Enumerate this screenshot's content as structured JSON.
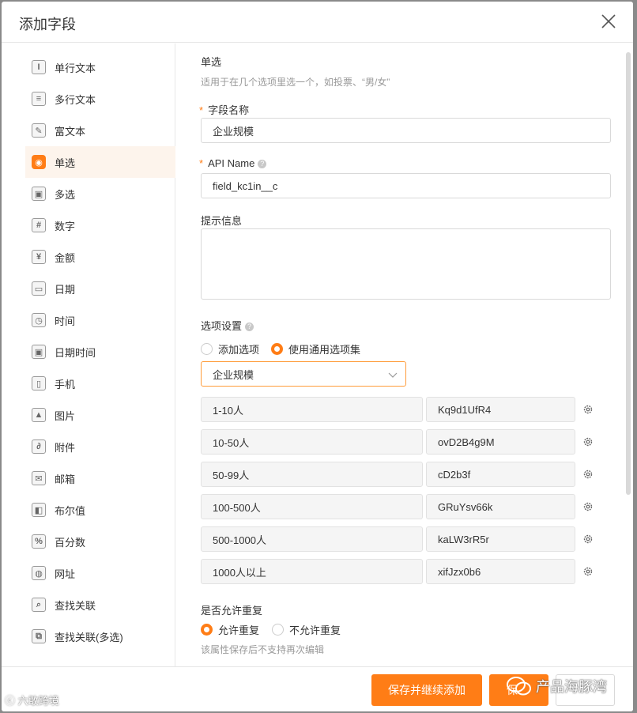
{
  "dialog": {
    "title": "添加字段"
  },
  "sidebar": {
    "items": [
      {
        "label": "单行文本",
        "glyph": "I",
        "icon": "single-line-text-icon"
      },
      {
        "label": "多行文本",
        "glyph": "≡",
        "icon": "multi-line-text-icon"
      },
      {
        "label": "富文本",
        "glyph": "✎",
        "icon": "rich-text-icon"
      },
      {
        "label": "单选",
        "glyph": "◉",
        "icon": "single-select-icon"
      },
      {
        "label": "多选",
        "glyph": "▣",
        "icon": "multi-select-icon"
      },
      {
        "label": "数字",
        "glyph": "#",
        "icon": "number-icon"
      },
      {
        "label": "金额",
        "glyph": "¥",
        "icon": "currency-icon"
      },
      {
        "label": "日期",
        "glyph": "▭",
        "icon": "date-icon"
      },
      {
        "label": "时间",
        "glyph": "◷",
        "icon": "time-icon"
      },
      {
        "label": "日期时间",
        "glyph": "▣",
        "icon": "datetime-icon"
      },
      {
        "label": "手机",
        "glyph": "▯",
        "icon": "phone-icon"
      },
      {
        "label": "图片",
        "glyph": "▲",
        "icon": "image-icon"
      },
      {
        "label": "附件",
        "glyph": "∂",
        "icon": "attachment-icon"
      },
      {
        "label": "邮箱",
        "glyph": "✉",
        "icon": "email-icon"
      },
      {
        "label": "布尔值",
        "glyph": "◧",
        "icon": "boolean-icon"
      },
      {
        "label": "百分数",
        "glyph": "%",
        "icon": "percent-icon"
      },
      {
        "label": "网址",
        "glyph": "◍",
        "icon": "url-icon"
      },
      {
        "label": "查找关联",
        "glyph": "⌕",
        "icon": "lookup-icon"
      },
      {
        "label": "查找关联(多选)",
        "glyph": "⧉",
        "icon": "lookup-multi-icon"
      }
    ],
    "active_index": 3
  },
  "form": {
    "type_title": "单选",
    "type_desc": "适用于在几个选项里选一个，如投票、“男/女”",
    "required_mark": "*",
    "field_name_label": "字段名称",
    "field_name_value": "企业规模",
    "api_name_label": "API Name",
    "api_name_value": "field_kc1in__c",
    "help_glyph": "?",
    "hint_label": "提示信息",
    "options_label": "选项设置",
    "option_mode_add": "添加选项",
    "option_mode_common": "使用通用选项集",
    "option_set_selected": "企业规模",
    "options": [
      {
        "label": "1-10人",
        "key": "Kq9d1UfR4"
      },
      {
        "label": "10-50人",
        "key": "ovD2B4g9M"
      },
      {
        "label": "50-99人",
        "key": "cD2b3f"
      },
      {
        "label": "100-500人",
        "key": "GRuYsv66k"
      },
      {
        "label": "500-1000人",
        "key": "kaLW3rR5r"
      },
      {
        "label": "1000人以上",
        "key": "xifJzx0b6"
      }
    ],
    "allow_dup_label": "是否允许重复",
    "allow_dup_yes": "允许重复",
    "allow_dup_no": "不允许重复",
    "allow_dup_hint": "该属性保存后不支持再次编辑"
  },
  "footer": {
    "save_continue": "保存并继续添加",
    "save_partial": "保",
    "cancel_partial": ""
  },
  "watermarks": {
    "right": "产品海豚湾",
    "left": "六敢跨境"
  },
  "colors": {
    "accent": "#ff7d16",
    "active_bg": "#fdf4ec"
  }
}
